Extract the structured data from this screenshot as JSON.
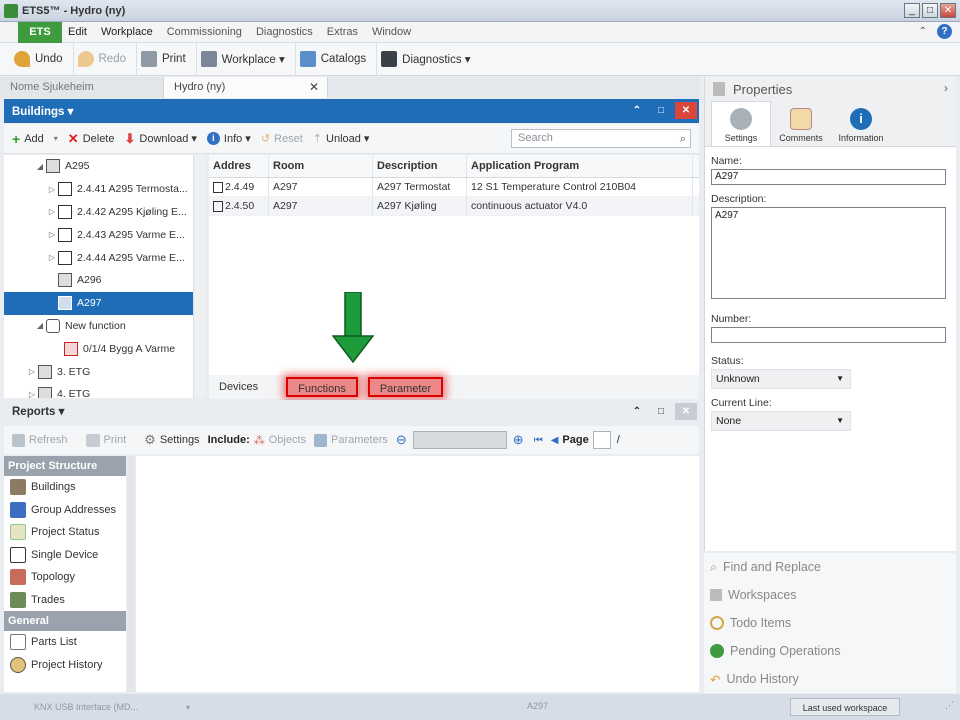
{
  "window": {
    "title": "ETS5™ - Hydro (ny)",
    "min": "_",
    "max": "□",
    "close": "✕"
  },
  "menu": {
    "ets": "ETS",
    "items": [
      "Edit",
      "Workplace",
      "Commissioning",
      "Diagnostics",
      "Extras",
      "Window"
    ]
  },
  "toolbar": {
    "undo": "Undo",
    "redo": "Redo",
    "print": "Print",
    "workplace": "Workplace ▾",
    "catalogs": "Catalogs",
    "diagnostics": "Diagnostics ▾"
  },
  "doc_tabs": [
    "Nome Sjukeheim",
    "Hydro (ny)"
  ],
  "buildings": {
    "title": "Buildings ▾",
    "toolbar": {
      "add": "Add",
      "delete": "Delete",
      "download": "Download ▾",
      "info": "Info ▾",
      "reset": "Reset",
      "unload": "Unload ▾",
      "search_placeholder": "Search"
    },
    "tree": [
      {
        "label": "A295",
        "arrow": "◢"
      },
      {
        "label": "2.4.41 A295 Termosta...",
        "arrow": "▷"
      },
      {
        "label": "2.4.42 A295 Kjøling E...",
        "arrow": "▷"
      },
      {
        "label": "2.4.43 A295 Varme E...",
        "arrow": "▷"
      },
      {
        "label": "2.4.44 A295 Varme E...",
        "arrow": "▷"
      },
      {
        "label": "A296",
        "arrow": ""
      },
      {
        "label": "A297",
        "arrow": ""
      },
      {
        "label": "New function",
        "arrow": "◢"
      },
      {
        "label": "0/1/4 Bygg A Varme",
        "arrow": ""
      },
      {
        "label": "3. ETG",
        "arrow": "▷"
      },
      {
        "label": "4. ETG",
        "arrow": "▷"
      }
    ],
    "grid": {
      "headers": [
        "Addres",
        "Room",
        "Description",
        "Application Program"
      ],
      "rows": [
        [
          "2.4.49",
          "A297",
          "A297 Termostat",
          "12 S1 Temperature Control  210B04"
        ],
        [
          "2.4.50",
          "A297",
          "A297 Kjøling",
          "continuous actuator V4.0"
        ]
      ]
    },
    "bottom_tabs": [
      "Devices",
      "Functions",
      "Parameter"
    ]
  },
  "reports": {
    "title": "Reports ▾",
    "toolbar": {
      "refresh": "Refresh",
      "print": "Print",
      "settings": "Settings",
      "include": "Include:",
      "objects": "Objects",
      "parameters": "Parameters",
      "page": "Page",
      "slash": "/"
    },
    "sections": [
      {
        "title": "Project Structure",
        "items": [
          "Buildings",
          "Group Addresses",
          "Project Status",
          "Single Device",
          "Topology",
          "Trades"
        ]
      },
      {
        "title": "General",
        "items": [
          "Parts List",
          "Project History"
        ]
      }
    ]
  },
  "properties": {
    "title": "Properties",
    "tabs": [
      "Settings",
      "Comments",
      "Information"
    ],
    "name_label": "Name:",
    "name_value": "A297",
    "description_label": "Description:",
    "description_value": "A297",
    "number_label": "Number:",
    "number_value": "",
    "status_label": "Status:",
    "status_value": "Unknown",
    "current_line_label": "Current Line:",
    "current_line_value": "None"
  },
  "side_links": [
    "Find and Replace",
    "Workspaces",
    "Todo Items",
    "Pending Operations",
    "Undo History"
  ],
  "status": {
    "interface": "KNX USB Interface (MD...",
    "center": "A297",
    "workspace": "Last used workspace"
  },
  "colors": {
    "accent": "#1f6db7",
    "ets_green": "#3e9b3e",
    "highlight_red": "#dd0000",
    "arrow_green": "#1e9b3a"
  }
}
